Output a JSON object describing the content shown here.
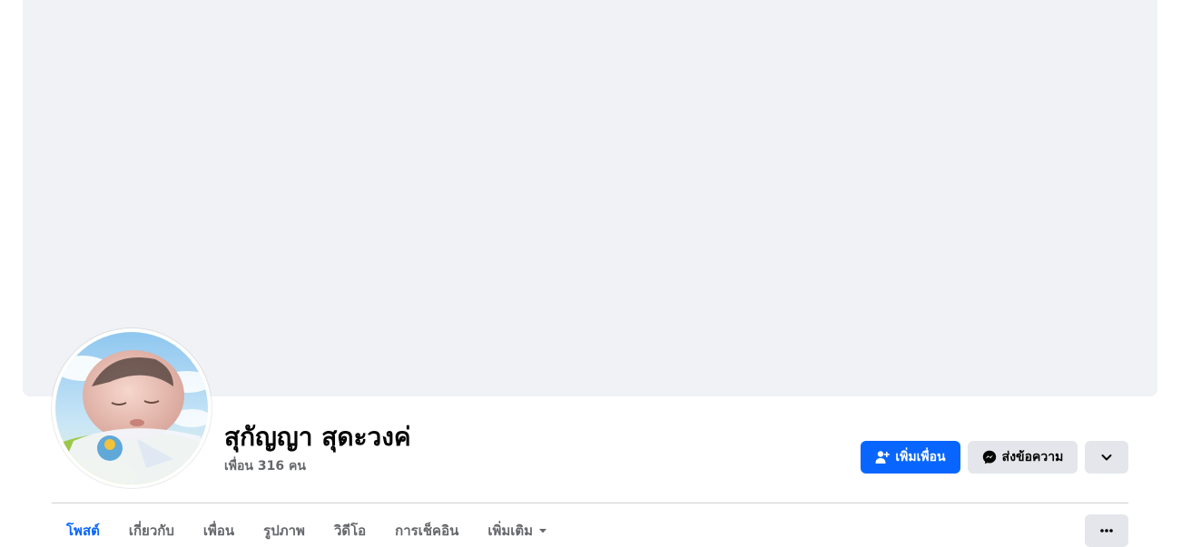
{
  "profile": {
    "name": "สุกัญญา สุดะวงค่",
    "friends_count": "เพื่อน 316 คน"
  },
  "actions": {
    "add_friend_label": "เพิ่มเพื่อน",
    "message_label": "ส่งข้อความ"
  },
  "tabs": [
    {
      "label": "โพสต์"
    },
    {
      "label": "เกี่ยวกับ"
    },
    {
      "label": "เพื่อน"
    },
    {
      "label": "รูปภาพ"
    },
    {
      "label": "วิดีโอ"
    },
    {
      "label": "การเช็คอิน"
    },
    {
      "label": "เพิ่มเติม"
    }
  ],
  "icons": {
    "add_friend": "person-add-icon",
    "message": "messenger-icon",
    "dropdown": "chevron-down-icon",
    "more_tab": "caret-down-icon",
    "more_options": "ellipsis-icon"
  },
  "colors": {
    "primary": "#0866ff",
    "secondary_bg": "#e4e6eb",
    "cover_bg": "#f0f2f5",
    "muted_text": "#65676b",
    "text": "#050505"
  }
}
